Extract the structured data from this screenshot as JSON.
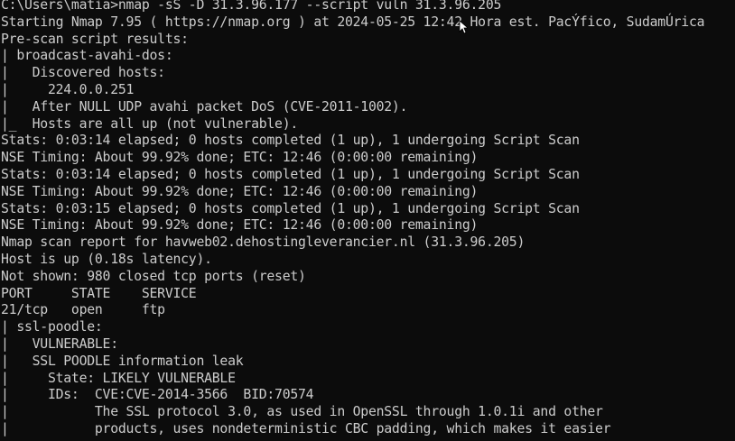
{
  "terminal": {
    "lines": [
      "C:\\Users\\matia>nmap -sS -D 31.3.96.177 --script vuln 31.3.96.205",
      "Starting Nmap 7.95 ( https://nmap.org ) at 2024-05-25 12:42 Hora est. PacÝfico, SudamÚrica",
      "Pre-scan script results:",
      "| broadcast-avahi-dos:",
      "|   Discovered hosts:",
      "|     224.0.0.251",
      "|   After NULL UDP avahi packet DoS (CVE-2011-1002).",
      "|_  Hosts are all up (not vulnerable).",
      "Stats: 0:03:14 elapsed; 0 hosts completed (1 up), 1 undergoing Script Scan",
      "NSE Timing: About 99.92% done; ETC: 12:46 (0:00:00 remaining)",
      "Stats: 0:03:14 elapsed; 0 hosts completed (1 up), 1 undergoing Script Scan",
      "NSE Timing: About 99.92% done; ETC: 12:46 (0:00:00 remaining)",
      "Stats: 0:03:15 elapsed; 0 hosts completed (1 up), 1 undergoing Script Scan",
      "NSE Timing: About 99.92% done; ETC: 12:46 (0:00:00 remaining)",
      "Nmap scan report for havweb02.dehostingleverancier.nl (31.3.96.205)",
      "Host is up (0.18s latency).",
      "Not shown: 980 closed tcp ports (reset)",
      "PORT     STATE    SERVICE",
      "21/tcp   open     ftp",
      "| ssl-poodle:",
      "|   VULNERABLE:",
      "|   SSL POODLE information leak",
      "|     State: LIKELY VULNERABLE",
      "|     IDs:  CVE:CVE-2014-3566  BID:70574",
      "|           The SSL protocol 3.0, as used in OpenSSL through 1.0.1i and other",
      "|           products, uses nondeterministic CBC padding, which makes it easier"
    ]
  },
  "colors": {
    "background": "#0c0c0c",
    "text": "#cccccc"
  },
  "cursor_icon": "mouse-pointer-icon"
}
